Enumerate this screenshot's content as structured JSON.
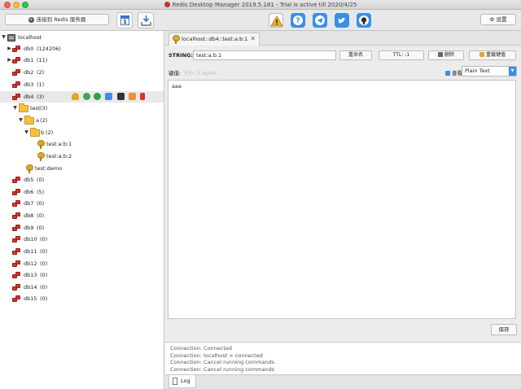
{
  "window": {
    "title": "Redis Desktop Manager 2019.5.181 - Trial is active till 2020/4/25"
  },
  "toolbar": {
    "connect_label": "连接到 Redis 服务器",
    "settings_label": "设置"
  },
  "tree": {
    "server": "localhost",
    "databases": [
      {
        "name": "db0",
        "count": "(124206)"
      },
      {
        "name": "db1",
        "count": "(11)"
      },
      {
        "name": "db2",
        "count": "(2)"
      },
      {
        "name": "db3",
        "count": "(1)"
      },
      {
        "name": "db4",
        "count": "(3)"
      },
      {
        "name": "db5",
        "count": "(0)"
      },
      {
        "name": "db6",
        "count": "(5)"
      },
      {
        "name": "db7",
        "count": "(0)"
      },
      {
        "name": "db8",
        "count": "(0)"
      },
      {
        "name": "db9",
        "count": "(0)"
      },
      {
        "name": "db10",
        "count": "(0)"
      },
      {
        "name": "db11",
        "count": "(0)"
      },
      {
        "name": "db12",
        "count": "(0)"
      },
      {
        "name": "db13",
        "count": "(0)"
      },
      {
        "name": "db14",
        "count": "(0)"
      },
      {
        "name": "db15",
        "count": "(0)"
      }
    ],
    "folder_test": {
      "name": "test",
      "count": "(3)"
    },
    "folder_a": {
      "name": "a",
      "count": "(2)"
    },
    "folder_b": {
      "name": "b",
      "count": "(2)"
    },
    "keys": [
      "test:a:b:1",
      "test:a:b:2"
    ],
    "key_demo": "test:demo"
  },
  "tab": {
    "label": "localhost::db4::test:a:b:1",
    "close": "✕"
  },
  "value_panel": {
    "type_label": "STRING:",
    "key_value": "test:a:b:1",
    "rename_label": "重命名",
    "ttl_label": "TTL: -1",
    "delete_label": "删除",
    "reload_label": "重载键值",
    "size_label": "键值:",
    "size_extra": "大小: 3 bytes",
    "view_label": "查看",
    "view_mode": "Plain Text",
    "content": "aaa",
    "save_label": "保存"
  },
  "log": {
    "lines": [
      "Connection: Connected",
      "Connection: localhost > connected",
      "Connection: Cancel running commands",
      "Connection: Cancel running commands"
    ],
    "tab_label": "Log"
  },
  "colors": {
    "db_red": "#d1352d",
    "folder_yellow": "#f4c242",
    "key_gold": "#e0a72a",
    "accent_blue": "#3a8ee6"
  }
}
